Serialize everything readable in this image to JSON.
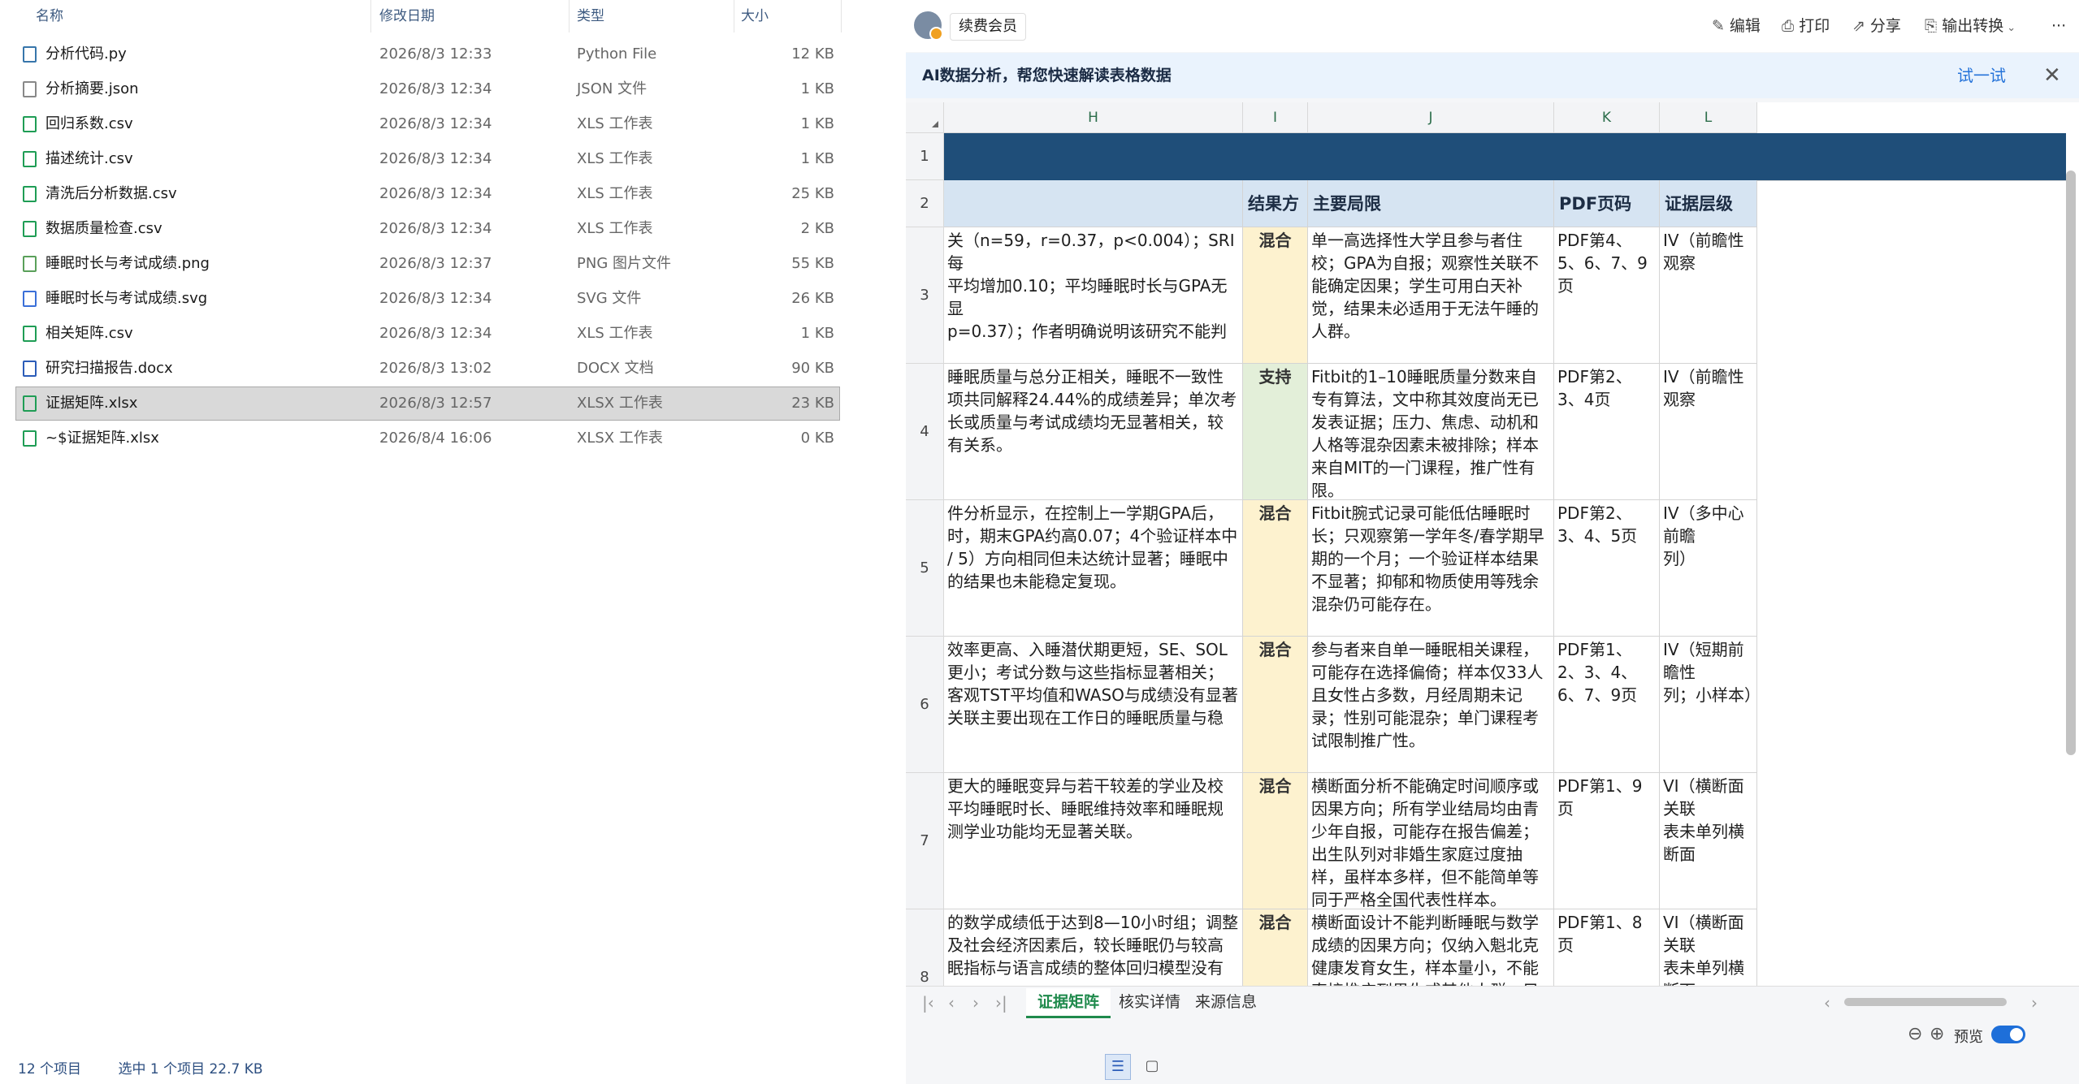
{
  "explorer": {
    "columns": {
      "name": "名称",
      "date": "修改日期",
      "type": "类型",
      "size": "大小"
    },
    "files": [
      {
        "name": "分析代码.py",
        "date": "2026/8/3 12:33",
        "type": "Python File",
        "size": "12 KB",
        "icon": "python-file-icon",
        "color": "#3776ab"
      },
      {
        "name": "分析摘要.json",
        "date": "2026/8/3 12:34",
        "type": "JSON 文件",
        "size": "1 KB",
        "icon": "json-file-icon",
        "color": "#888888"
      },
      {
        "name": "回归系数.csv",
        "date": "2026/8/3 12:34",
        "type": "XLS 工作表",
        "size": "1 KB",
        "icon": "spreadsheet-file-icon",
        "color": "#1f9d55"
      },
      {
        "name": "描述统计.csv",
        "date": "2026/8/3 12:34",
        "type": "XLS 工作表",
        "size": "1 KB",
        "icon": "spreadsheet-file-icon",
        "color": "#1f9d55"
      },
      {
        "name": "清洗后分析数据.csv",
        "date": "2026/8/3 12:34",
        "type": "XLS 工作表",
        "size": "25 KB",
        "icon": "spreadsheet-file-icon",
        "color": "#1f9d55"
      },
      {
        "name": "数据质量检查.csv",
        "date": "2026/8/3 12:34",
        "type": "XLS 工作表",
        "size": "2 KB",
        "icon": "spreadsheet-file-icon",
        "color": "#1f9d55"
      },
      {
        "name": "睡眠时长与考试成绩.png",
        "date": "2026/8/3 12:37",
        "type": "PNG 图片文件",
        "size": "55 KB",
        "icon": "image-file-icon",
        "color": "#5aa05a"
      },
      {
        "name": "睡眠时长与考试成绩.svg",
        "date": "2026/8/3 12:34",
        "type": "SVG 文件",
        "size": "26 KB",
        "icon": "svg-file-icon",
        "color": "#3a6fd8"
      },
      {
        "name": "相关矩阵.csv",
        "date": "2026/8/3 12:34",
        "type": "XLS 工作表",
        "size": "1 KB",
        "icon": "spreadsheet-file-icon",
        "color": "#1f9d55"
      },
      {
        "name": "研究扫描报告.docx",
        "date": "2026/8/3 13:02",
        "type": "DOCX 文档",
        "size": "90 KB",
        "icon": "word-file-icon",
        "color": "#2b5cb8"
      },
      {
        "name": "证据矩阵.xlsx",
        "date": "2026/8/3 12:57",
        "type": "XLSX 工作表",
        "size": "23 KB",
        "icon": "excel-file-icon",
        "color": "#1f9d55",
        "selected": true
      },
      {
        "name": "~$证据矩阵.xlsx",
        "date": "2026/8/4 16:06",
        "type": "XLSX 工作表",
        "size": "0 KB",
        "icon": "excel-file-icon",
        "color": "#1f9d55"
      }
    ],
    "status": {
      "count": "12 个项目",
      "selected": "选中 1 个项目  22.7 KB"
    }
  },
  "preview": {
    "vip": "续费会员",
    "tools": {
      "edit": "编辑",
      "print": "打印",
      "share": "分享",
      "export": "输出转换",
      "more": "···"
    },
    "banner": {
      "text": "AI数据分析，帮您快速解读表格数据",
      "try": "试一试"
    },
    "columns": [
      "H",
      "I",
      "J",
      "K",
      "L"
    ],
    "header_row": {
      "direction": "结果方向",
      "limits": "主要局限",
      "pdf": "PDF页码",
      "level": "证据层级"
    },
    "rows": [
      {
        "num": "3",
        "h": "关（n=59，r=0.37，p<0.004）；SRI每\n平均增加0.10；平均睡眠时长与GPA无显\np=0.37）；作者明确说明该研究不能判",
        "dir": "混合",
        "lim": "单一高选择性大学且参与者住校；GPA为自报；观察性关联不能确定因果；学生可用白天补觉，结果未必适用于无法午睡的人群。",
        "pdf": "PDF第4、5、6、7、9页",
        "lvl": "IV（前瞻性观察"
      },
      {
        "num": "4",
        "h": "睡眠质量与总分正相关，睡眠不一致性\n项共同解释24.44%的成绩差异；单次考\n长或质量与考试成绩均无显著相关，较\n有关系。",
        "dir": "支持",
        "lim": "Fitbit的1–10睡眠质量分数来自专有算法，文中称其效度尚无已发表证据；压力、焦虑、动机和人格等混杂因素未被排除；样本来自MIT的一门课程，推广性有限。",
        "pdf": "PDF第2、3、4页",
        "lvl": "IV（前瞻性观察"
      },
      {
        "num": "5",
        "h": "件分析显示，在控制上一学期GPA后，\n时，期末GPA约高0.07；4个验证样本中\n/ 5）方向相同但未达统计显著；睡眠中\n的结果也未能稳定复现。",
        "dir": "混合",
        "lim": "Fitbit腕式记录可能低估睡眠时长；只观察第一学年冬/春学期早期的一个月；一个验证样本结果不显著；抑郁和物质使用等残余混杂仍可能存在。",
        "pdf": "PDF第2、3、4、5页",
        "lvl": "IV（多中心前瞻\n列）"
      },
      {
        "num": "6",
        "h": "效率更高、入睡潜伏期更短，SE、SOL\n更小；考试分数与这些指标显著相关；\n客观TST平均值和WASO与成绩没有显著\n关联主要出现在工作日的睡眠质量与稳",
        "dir": "混合",
        "lim": "参与者来自单一睡眠相关课程，可能存在选择偏倚；样本仅33人且女性占多数，月经周期未记录；性别可能混杂；单门课程考试限制推广性。",
        "pdf": "PDF第1、2、3、4、6、7、9页",
        "lvl": "IV（短期前瞻性\n列；小样本）"
      },
      {
        "num": "7",
        "h": "更大的睡眠变异与若干较差的学业及校\n平均睡眠时长、睡眠维持效率和睡眠规\n测学业功能均无显著关联。",
        "dir": "混合",
        "lim": "横断面分析不能确定时间顺序或因果方向；所有学业结局均由青少年自报，可能存在报告偏差；出生队列对非婚生家庭过度抽样，虽样本多样，但不能简单等同于严格全国代表性样本。",
        "pdf": "PDF第1、9页",
        "lvl": "VI（横断面关联\n表未单列横断面"
      },
      {
        "num": "8",
        "h": "的数学成绩低于达到8—10小时组；调整\n及社会经济因素后，较长睡眠仍与较高\n眠指标与语言成绩的整体回归模型没有",
        "dir": "混合",
        "lim": "横断面设计不能判断睡眠与数学成绩的因果方向；仅纳入魁北克健康发育女生，样本量小，不能直接推广到男生或其他人群；只记录上学日晚睡眠，没有要着因素",
        "pdf": "PDF第1、8页",
        "lvl": "VI（横断面关联\n表未单列横断面"
      }
    ],
    "tabs": [
      "证据矩阵",
      "核实详情",
      "来源信息"
    ],
    "preview_label": "预览"
  }
}
